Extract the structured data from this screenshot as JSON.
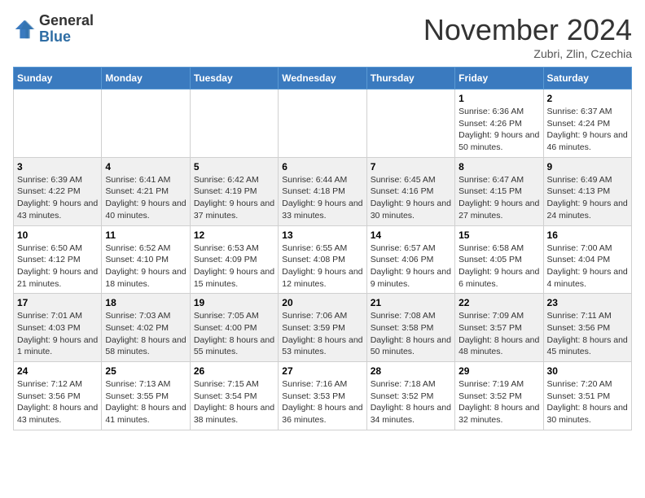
{
  "header": {
    "logo_general": "General",
    "logo_blue": "Blue",
    "month_title": "November 2024",
    "location": "Zubri, Zlin, Czechia"
  },
  "days_of_week": [
    "Sunday",
    "Monday",
    "Tuesday",
    "Wednesday",
    "Thursday",
    "Friday",
    "Saturday"
  ],
  "weeks": [
    [
      {
        "day": "",
        "info": ""
      },
      {
        "day": "",
        "info": ""
      },
      {
        "day": "",
        "info": ""
      },
      {
        "day": "",
        "info": ""
      },
      {
        "day": "",
        "info": ""
      },
      {
        "day": "1",
        "info": "Sunrise: 6:36 AM\nSunset: 4:26 PM\nDaylight: 9 hours and 50 minutes."
      },
      {
        "day": "2",
        "info": "Sunrise: 6:37 AM\nSunset: 4:24 PM\nDaylight: 9 hours and 46 minutes."
      }
    ],
    [
      {
        "day": "3",
        "info": "Sunrise: 6:39 AM\nSunset: 4:22 PM\nDaylight: 9 hours and 43 minutes."
      },
      {
        "day": "4",
        "info": "Sunrise: 6:41 AM\nSunset: 4:21 PM\nDaylight: 9 hours and 40 minutes."
      },
      {
        "day": "5",
        "info": "Sunrise: 6:42 AM\nSunset: 4:19 PM\nDaylight: 9 hours and 37 minutes."
      },
      {
        "day": "6",
        "info": "Sunrise: 6:44 AM\nSunset: 4:18 PM\nDaylight: 9 hours and 33 minutes."
      },
      {
        "day": "7",
        "info": "Sunrise: 6:45 AM\nSunset: 4:16 PM\nDaylight: 9 hours and 30 minutes."
      },
      {
        "day": "8",
        "info": "Sunrise: 6:47 AM\nSunset: 4:15 PM\nDaylight: 9 hours and 27 minutes."
      },
      {
        "day": "9",
        "info": "Sunrise: 6:49 AM\nSunset: 4:13 PM\nDaylight: 9 hours and 24 minutes."
      }
    ],
    [
      {
        "day": "10",
        "info": "Sunrise: 6:50 AM\nSunset: 4:12 PM\nDaylight: 9 hours and 21 minutes."
      },
      {
        "day": "11",
        "info": "Sunrise: 6:52 AM\nSunset: 4:10 PM\nDaylight: 9 hours and 18 minutes."
      },
      {
        "day": "12",
        "info": "Sunrise: 6:53 AM\nSunset: 4:09 PM\nDaylight: 9 hours and 15 minutes."
      },
      {
        "day": "13",
        "info": "Sunrise: 6:55 AM\nSunset: 4:08 PM\nDaylight: 9 hours and 12 minutes."
      },
      {
        "day": "14",
        "info": "Sunrise: 6:57 AM\nSunset: 4:06 PM\nDaylight: 9 hours and 9 minutes."
      },
      {
        "day": "15",
        "info": "Sunrise: 6:58 AM\nSunset: 4:05 PM\nDaylight: 9 hours and 6 minutes."
      },
      {
        "day": "16",
        "info": "Sunrise: 7:00 AM\nSunset: 4:04 PM\nDaylight: 9 hours and 4 minutes."
      }
    ],
    [
      {
        "day": "17",
        "info": "Sunrise: 7:01 AM\nSunset: 4:03 PM\nDaylight: 9 hours and 1 minute."
      },
      {
        "day": "18",
        "info": "Sunrise: 7:03 AM\nSunset: 4:02 PM\nDaylight: 8 hours and 58 minutes."
      },
      {
        "day": "19",
        "info": "Sunrise: 7:05 AM\nSunset: 4:00 PM\nDaylight: 8 hours and 55 minutes."
      },
      {
        "day": "20",
        "info": "Sunrise: 7:06 AM\nSunset: 3:59 PM\nDaylight: 8 hours and 53 minutes."
      },
      {
        "day": "21",
        "info": "Sunrise: 7:08 AM\nSunset: 3:58 PM\nDaylight: 8 hours and 50 minutes."
      },
      {
        "day": "22",
        "info": "Sunrise: 7:09 AM\nSunset: 3:57 PM\nDaylight: 8 hours and 48 minutes."
      },
      {
        "day": "23",
        "info": "Sunrise: 7:11 AM\nSunset: 3:56 PM\nDaylight: 8 hours and 45 minutes."
      }
    ],
    [
      {
        "day": "24",
        "info": "Sunrise: 7:12 AM\nSunset: 3:56 PM\nDaylight: 8 hours and 43 minutes."
      },
      {
        "day": "25",
        "info": "Sunrise: 7:13 AM\nSunset: 3:55 PM\nDaylight: 8 hours and 41 minutes."
      },
      {
        "day": "26",
        "info": "Sunrise: 7:15 AM\nSunset: 3:54 PM\nDaylight: 8 hours and 38 minutes."
      },
      {
        "day": "27",
        "info": "Sunrise: 7:16 AM\nSunset: 3:53 PM\nDaylight: 8 hours and 36 minutes."
      },
      {
        "day": "28",
        "info": "Sunrise: 7:18 AM\nSunset: 3:52 PM\nDaylight: 8 hours and 34 minutes."
      },
      {
        "day": "29",
        "info": "Sunrise: 7:19 AM\nSunset: 3:52 PM\nDaylight: 8 hours and 32 minutes."
      },
      {
        "day": "30",
        "info": "Sunrise: 7:20 AM\nSunset: 3:51 PM\nDaylight: 8 hours and 30 minutes."
      }
    ]
  ]
}
